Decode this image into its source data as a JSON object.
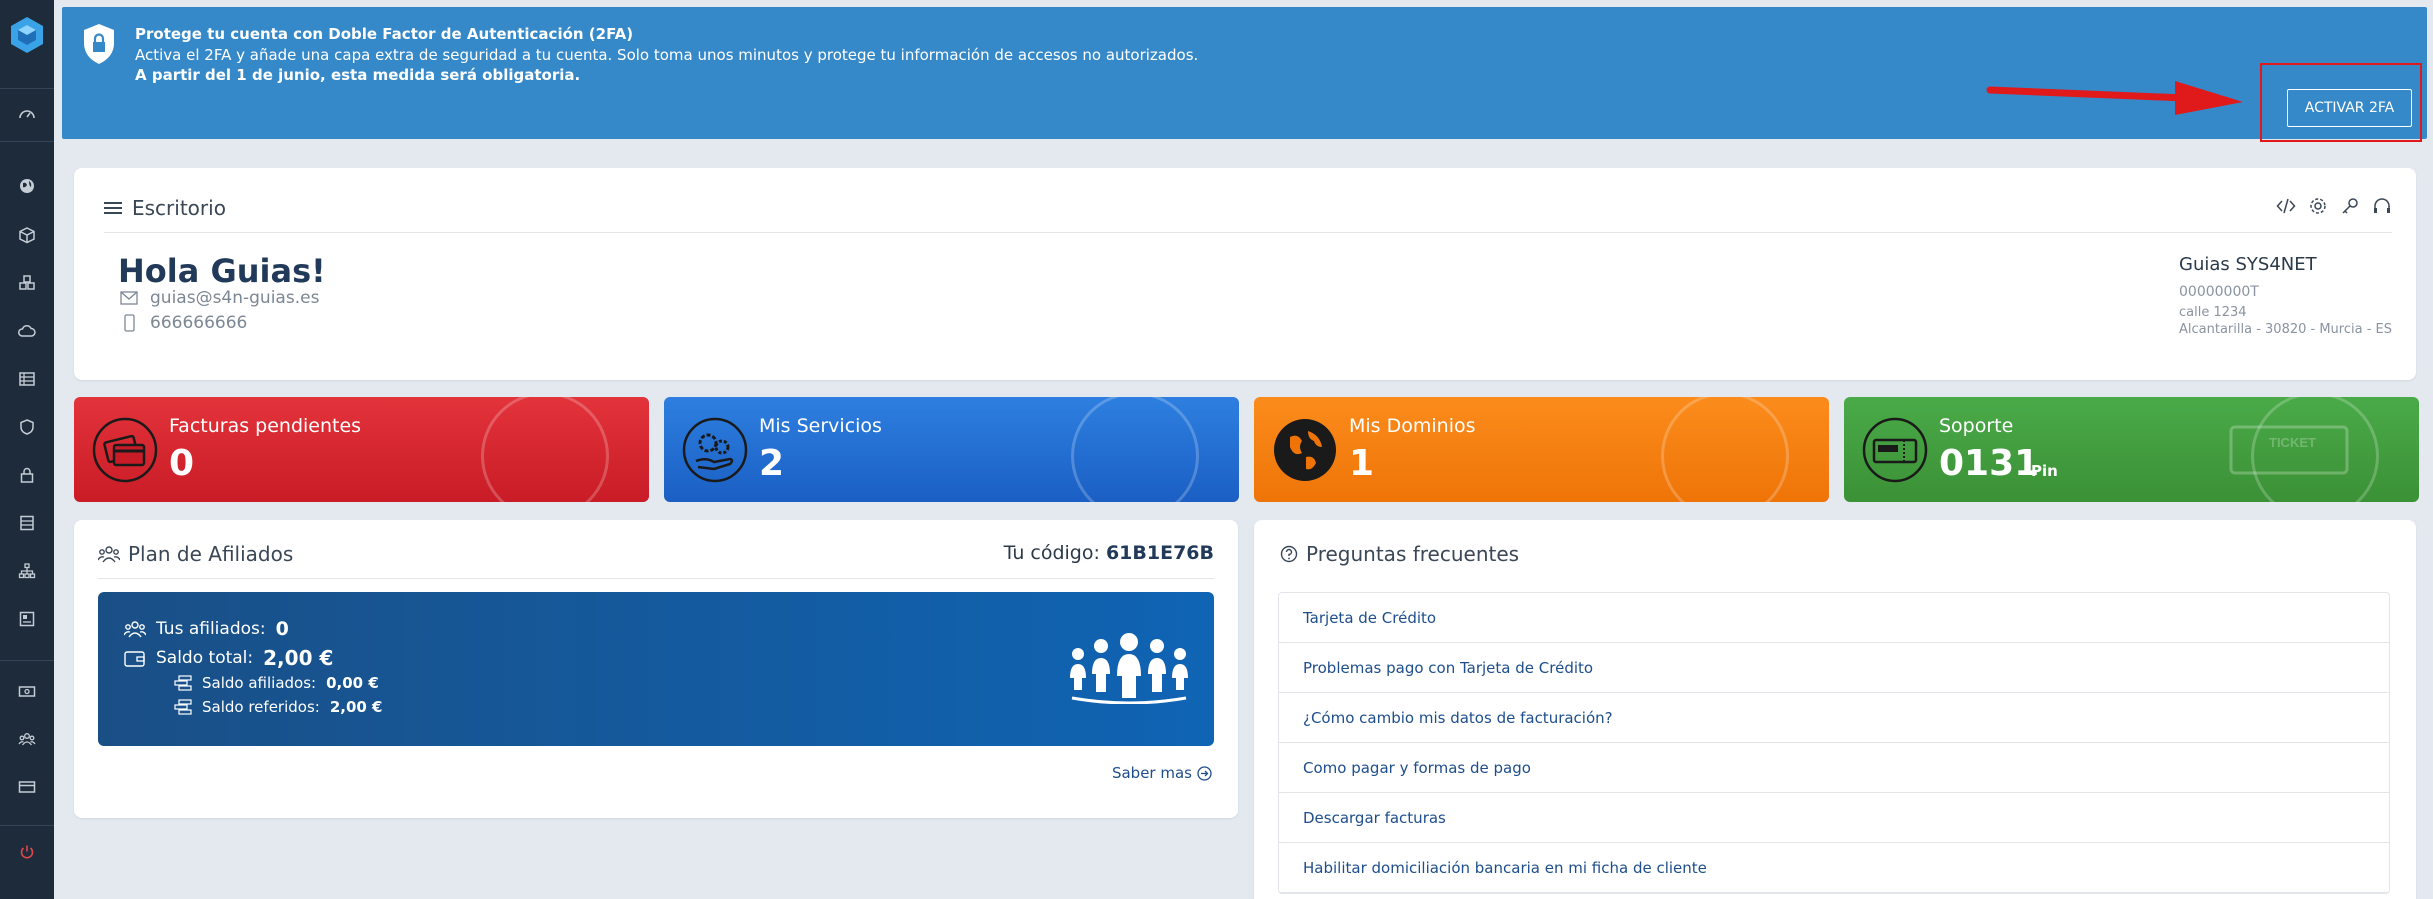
{
  "banner": {
    "title": "Protege tu cuenta con Doble Factor de Autenticación (2FA)",
    "text": "Activa el 2FA y añade una capa extra de seguridad a tu cuenta. Solo toma unos minutos y protege tu información de accesos no autorizados.",
    "warning": "A partir del 1 de junio, esta medida será obligatoria.",
    "button": "ACTIVAR 2FA"
  },
  "desk": {
    "title": "Escritorio",
    "greeting": "Hola Guias!",
    "email": "guias@s4n-guias.es",
    "phone": "666666666",
    "company": "Guias SYS4NET",
    "tax_id": "00000000T",
    "street": "calle 1234",
    "city": "Alcantarilla - 30820 - Murcia - ES"
  },
  "stats": {
    "invoices": {
      "label": "Facturas pendientes",
      "value": "0"
    },
    "services": {
      "label": "Mis Servicios",
      "value": "2"
    },
    "domains": {
      "label": "Mis Dominios",
      "value": "1"
    },
    "support": {
      "label": "Soporte",
      "value": "0131",
      "pin": "Pin",
      "bg_text": "TICKET"
    }
  },
  "affiliates": {
    "title": "Plan de Afiliados",
    "code_label": "Tu código:",
    "code": "61B1E76B",
    "affiliates_label": "Tus afiliados:",
    "affiliates_value": "0",
    "total_label": "Saldo total:",
    "total_value": "2,00 €",
    "aff_balance_label": "Saldo afiliados:",
    "aff_balance_value": "0,00 €",
    "ref_balance_label": "Saldo referidos:",
    "ref_balance_value": "2,00 €",
    "more": "Saber mas"
  },
  "faq": {
    "title": "Preguntas frecuentes",
    "items": [
      "Tarjeta de Crédito",
      "Problemas pago con Tarjeta de Crédito",
      "¿Cómo cambio mis datos de facturación?",
      "Como pagar y formas de pago",
      "Descargar facturas",
      "Habilitar domiciliación bancaria en mi ficha de cliente"
    ]
  },
  "colors": {
    "sidebar": "#1d2b3a",
    "banner": "#3689c9",
    "accent_red": "#e0191b"
  }
}
